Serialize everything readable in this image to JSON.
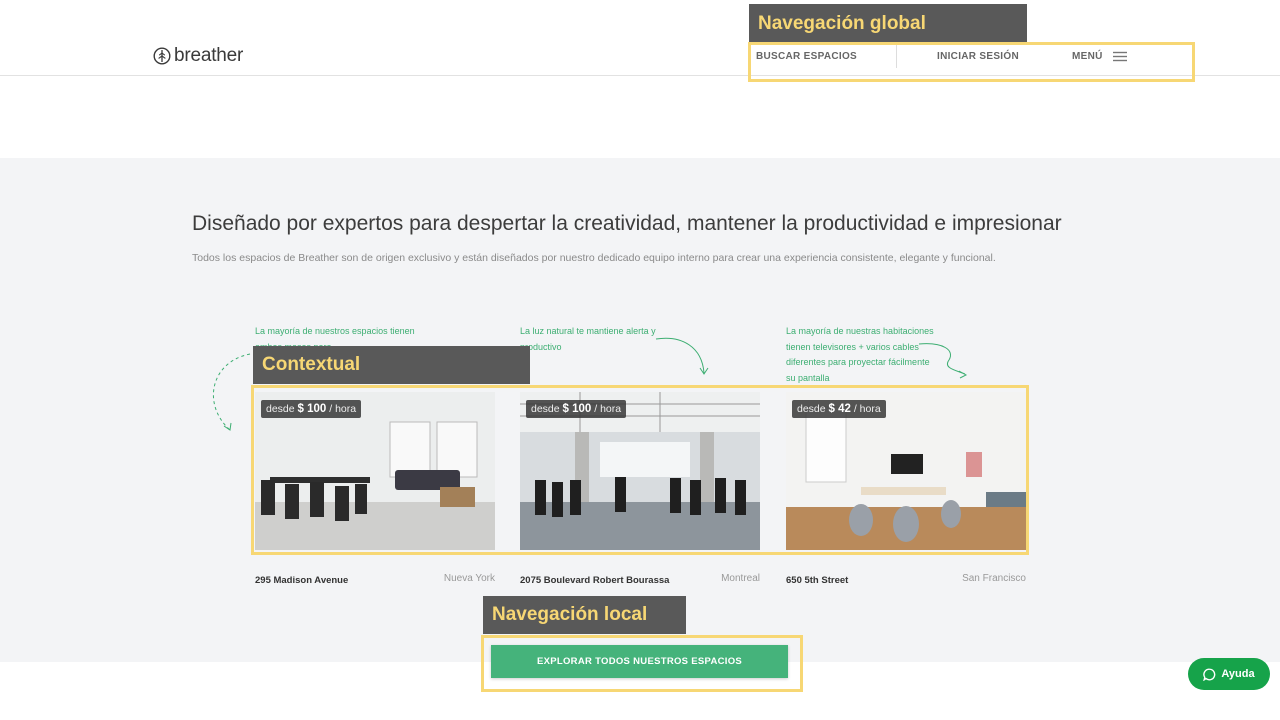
{
  "header": {
    "logo_text": "breather",
    "nav": {
      "search_label": "BUSCAR ESPACIOS",
      "login_label": "INICIAR SESIÓN",
      "menu_label": "MENÚ"
    }
  },
  "main": {
    "headline": "Diseñado por expertos para despertar la creatividad, mantener la productividad e impresionar",
    "subtext": "Todos los espacios de Breather son de origen exclusivo y están diseñados por nuestro dedicado equipo interno para crear una experiencia consistente, elegante y funcional.",
    "notes": [
      "La mayoría de nuestros espacios tienen ambas mesas para",
      "La luz natural te mantiene alerta y productivo",
      "La mayoría de nuestras habitaciones tienen televisores + varios cables diferentes para proyectar fácilmente su pantalla"
    ],
    "cards": [
      {
        "price_prefix": "desde",
        "price": "$ 100",
        "price_suffix": "/ hora",
        "address": "295 Madison Avenue",
        "city": "Nueva York"
      },
      {
        "price_prefix": "desde",
        "price": "$ 100",
        "price_suffix": "/ hora",
        "address": "2075 Boulevard Robert Bourassa",
        "city": "Montreal"
      },
      {
        "price_prefix": "desde",
        "price": "$ 42",
        "price_suffix": "/ hora",
        "address": "650 5th Street",
        "city": "San Francisco"
      }
    ],
    "explore_label": "EXPLORAR TODOS NUESTROS ESPACIOS"
  },
  "help": {
    "label": "Ayuda",
    "icon": "chat-bubble-icon"
  },
  "annotations": {
    "global_nav": "Navegación global",
    "contextual": "Contextual",
    "local_nav": "Navegación local"
  },
  "colors": {
    "accent_green": "#45b37b",
    "note_green": "#3dae72",
    "annotation_yellow": "#f7d774",
    "annotation_bg": "#595959",
    "section_bg": "#f3f4f6"
  }
}
